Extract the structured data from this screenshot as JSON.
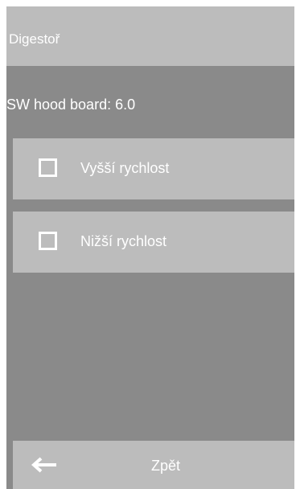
{
  "header": {
    "title": "Digestoř"
  },
  "info": {
    "text": "SW hood board: 6.0"
  },
  "options": [
    {
      "label": "Vyšší rychlost",
      "checked": false
    },
    {
      "label": "Nižší rychlost",
      "checked": false
    }
  ],
  "footer": {
    "back_label": "Zpět",
    "back_icon": "arrow-left-icon"
  },
  "colors": {
    "background": "#8a8a8a",
    "panel": "#bcbcbc",
    "text": "#ffffff"
  }
}
